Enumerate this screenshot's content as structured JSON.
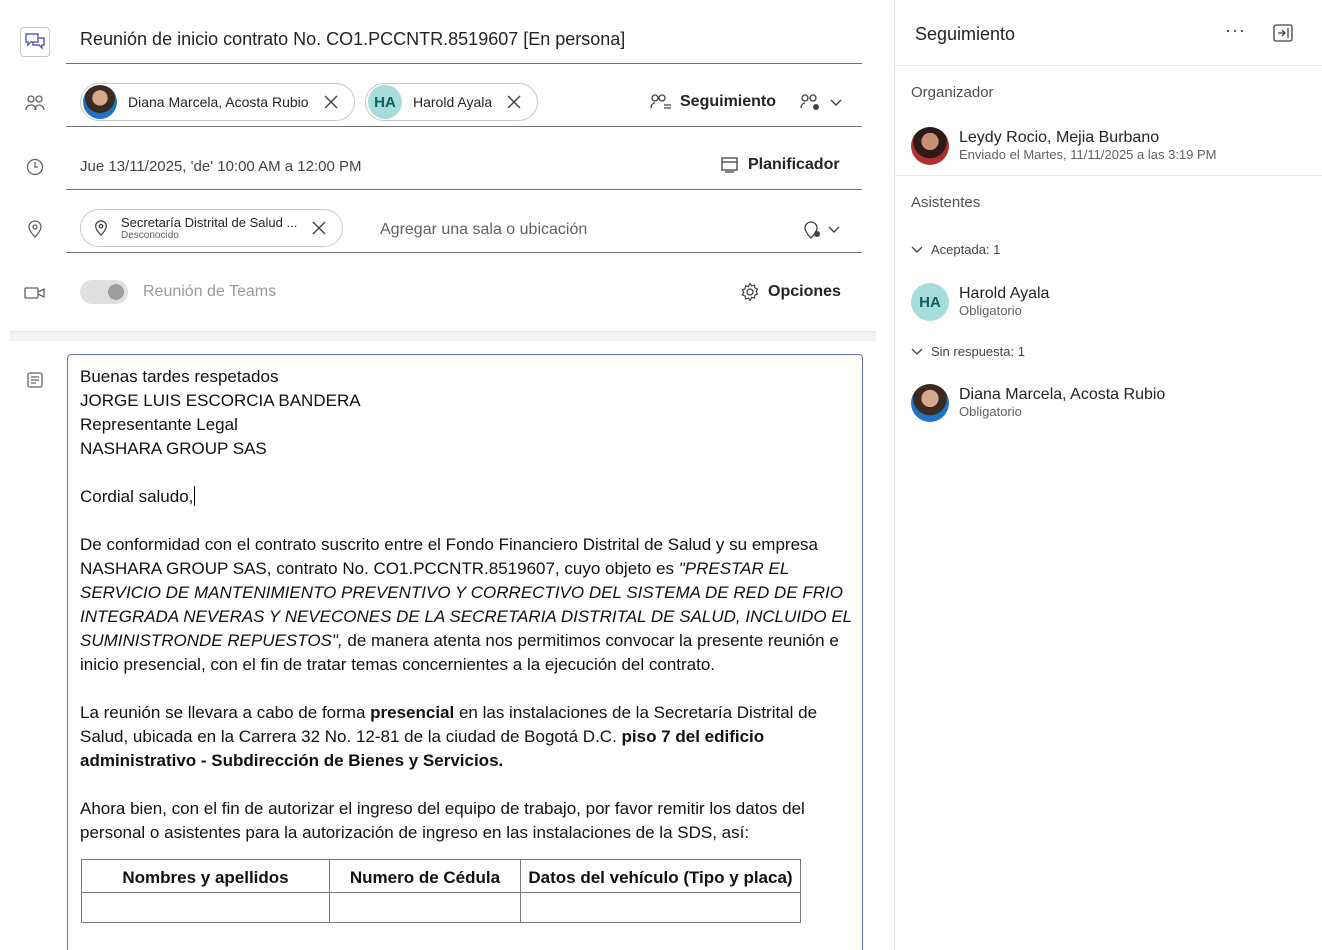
{
  "subject": "Reunión de inicio contrato No. CO1.PCCNTR.8519607 [En persona]",
  "attendees": {
    "chips": [
      {
        "name": "Diana Marcela, Acosta Rubio",
        "type": "photo"
      },
      {
        "name": "Harold Ayala",
        "initials": "HA",
        "type": "initials"
      }
    ],
    "tracking_label": "Seguimiento"
  },
  "datetime": {
    "value": "Jue 13/11/2025, 'de' 10:00 AM a 12:00 PM",
    "scheduler_label": "Planificador"
  },
  "location": {
    "chip_main": "Secretaría Distrital de Salud ...",
    "chip_sub": "Desconocido",
    "placeholder": "Agregar una sala o ubicación"
  },
  "teams": {
    "label": "Reunión de Teams",
    "options_label": "Opciones",
    "enabled": false
  },
  "body": {
    "line1": "Buenas tardes respetados",
    "line2": "JORGE LUIS ESCORCIA BANDERA",
    "line3": "Representante Legal",
    "line4": "NASHARA GROUP SAS",
    "greeting": "Cordial saludo,",
    "p1_a": "De conformidad con el contrato suscrito entre el Fondo Financiero Distrital de Salud y su empresa NASHARA GROUP SAS, contrato No. CO1.PCCNTR.8519607, cuyo objeto es ",
    "p1_italic": "\"PRESTAR EL SERVICIO DE MANTENIMIENTO PREVENTIVO Y CORRECTIVO DEL SISTEMA DE RED DE FRIO INTEGRADA NEVERAS Y NEVECONES DE LA SECRETARIA DISTRITAL DE SALUD, INCLUIDO EL SUMINISTRONDE REPUESTOS\",",
    "p1_b": "  de manera atenta nos permitimos convocar la presente reunión e inicio presencial, con el fin de tratar temas concernientes a la ejecución del contrato.",
    "p2_a": "La reunión se llevara a cabo de forma ",
    "p2_bold1": "presencial",
    "p2_b": " en las instalaciones de la Secretaría Distrital de Salud, ubicada en la Carrera 32 No. 12-81 de la ciudad de Bogotá D.C. ",
    "p2_bold2": "piso 7 del edificio administrativo - Subdirección de Bienes y Servicios.",
    "p3": "Ahora bien, con el fin de autorizar el ingreso del equipo de trabajo, por favor remitir los datos del personal o asistentes para la autorización de ingreso en las instalaciones de la SDS, así:",
    "table_headers": [
      "Nombres y apellidos",
      "Numero de Cédula",
      "Datos del vehículo (Tipo y placa)"
    ]
  },
  "side": {
    "title": "Seguimiento",
    "more": "···",
    "organizer_label": "Organizador",
    "organizer": {
      "name": "Leydy Rocio, Mejia Burbano",
      "sent": "Enviado el Martes, 11/11/2025 a las 3:19 PM"
    },
    "attendees_label": "Asistentes",
    "accepted_label": "Aceptada: 1",
    "accepted": [
      {
        "name": "Harold Ayala",
        "initials": "HA",
        "role": "Obligatorio"
      }
    ],
    "no_response_label": "Sin respuesta: 1",
    "no_response": [
      {
        "name": "Diana Marcela, Acosta Rubio",
        "role": "Obligatorio"
      }
    ]
  },
  "colors": {
    "accent": "#5b5fc7",
    "initials_bg": "#a6dcd9",
    "border": "#707070"
  }
}
